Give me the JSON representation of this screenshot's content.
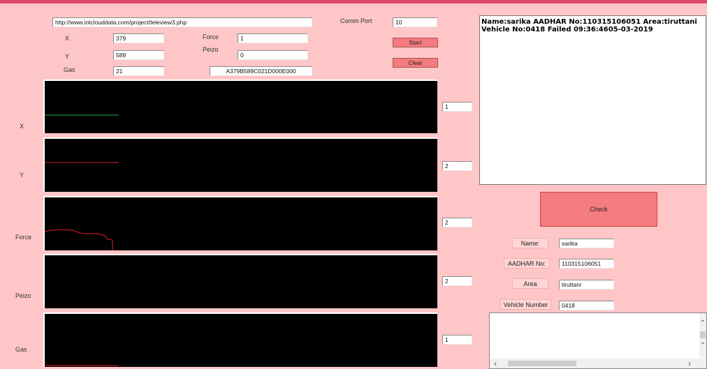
{
  "url": "http://www.iotclouddata.com/project/teleview3.php",
  "comm_port": {
    "label": "Comm Port",
    "value": "10"
  },
  "buttons": {
    "start": "Start",
    "clear": "Clear",
    "check": "Check"
  },
  "fields": {
    "x": {
      "label": "X",
      "value": "379"
    },
    "y": {
      "label": "Y",
      "value": "589"
    },
    "gas": {
      "label": "Gas",
      "value": "21"
    },
    "force": {
      "label": "Force",
      "value": "1"
    },
    "peizo": {
      "label": "Peizo",
      "value": "0"
    },
    "raw": "A379B589C021D000E000"
  },
  "graphs": [
    {
      "label": "X",
      "value": "1",
      "color": "#22b14c"
    },
    {
      "label": "Y",
      "value": "2",
      "color": "#e02020"
    },
    {
      "label": "Force",
      "value": "2",
      "color": "#e02020"
    },
    {
      "label": "Peizo",
      "value": "2",
      "color": "#e02020"
    },
    {
      "label": "Gas",
      "value": "1",
      "color": "#e02020"
    }
  ],
  "log_text": "Name:sarika AADHAR No:110315106051 Area:tiruttani Vehicle No:0418 Failed 09:36:4605-03-2019",
  "record": {
    "name_label": "Name:",
    "name": "sarika",
    "aadhar_label": "AADHAR No:",
    "aadhar": "110315106051",
    "area_label": "Area",
    "area": "tiruttani",
    "vehicle_label": "Vehicle Number",
    "vehicle": "0418"
  },
  "scroll_icons": {
    "up": "chevron-up-icon",
    "down": "chevron-down-icon",
    "left": "chevron-left-icon",
    "right": "chevron-right-icon"
  }
}
